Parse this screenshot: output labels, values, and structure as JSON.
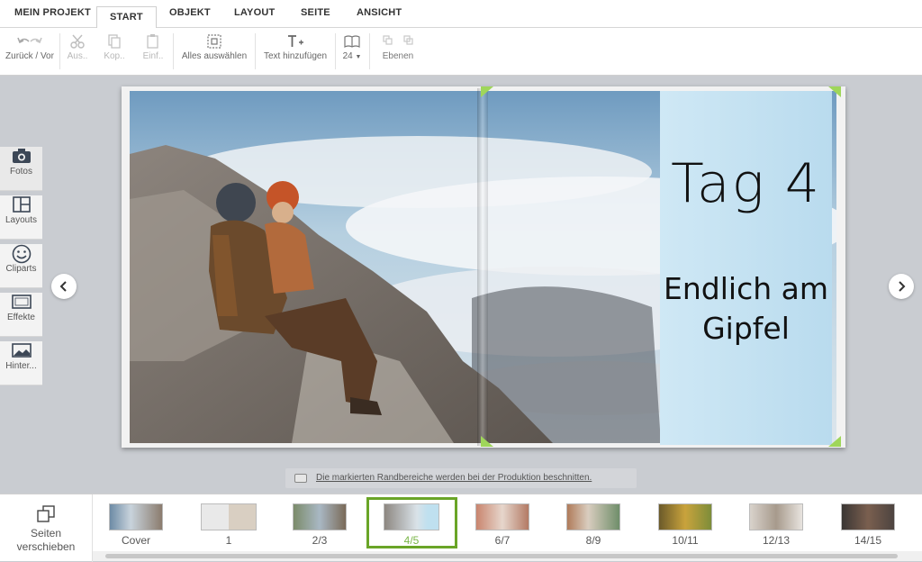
{
  "menu": {
    "tabs": [
      {
        "label": "MEIN PROJEKT",
        "active": false
      },
      {
        "label": "START",
        "active": true
      },
      {
        "label": "OBJEKT",
        "active": false
      },
      {
        "label": "LAYOUT",
        "active": false
      },
      {
        "label": "SEITE",
        "active": false
      },
      {
        "label": "ANSICHT",
        "active": false
      }
    ]
  },
  "toolbar": {
    "undo_redo_label": "Zurück / Vor",
    "cut_label": "Aus..",
    "copy_label": "Kop..",
    "paste_label": "Einf..",
    "select_all_label": "Alles auswählen",
    "add_text_label": "Text hinzufügen",
    "font_size_value": "24",
    "layers_label": "Ebenen"
  },
  "left_tools": [
    {
      "label": "Fotos",
      "icon": "camera-icon",
      "active": true
    },
    {
      "label": "Layouts",
      "icon": "layout-icon",
      "active": false
    },
    {
      "label": "Cliparts",
      "icon": "smiley-icon",
      "active": false
    },
    {
      "label": "Effekte",
      "icon": "frame-icon",
      "active": false
    },
    {
      "label": "Hinter...",
      "icon": "background-image-icon",
      "active": false
    }
  ],
  "spread": {
    "title_text": "Tag 4",
    "subtitle_line1": "Endlich am",
    "subtitle_line2": "Gipfel"
  },
  "cut_notice": "Die markierten Randbereiche werden bei der Produktion beschnitten.",
  "filmstrip": {
    "move_pages_line1": "Seiten",
    "move_pages_line2": "verschieben",
    "pages": [
      {
        "label": "Cover",
        "selected": false
      },
      {
        "label": "1",
        "selected": false
      },
      {
        "label": "2/3",
        "selected": false
      },
      {
        "label": "4/5",
        "selected": true
      },
      {
        "label": "6/7",
        "selected": false
      },
      {
        "label": "8/9",
        "selected": false
      },
      {
        "label": "10/11",
        "selected": false
      },
      {
        "label": "12/13",
        "selected": false
      },
      {
        "label": "14/15",
        "selected": false
      }
    ]
  },
  "colors": {
    "accent_green": "#6aa527",
    "text_panel_blue": "#c4e2f2"
  }
}
